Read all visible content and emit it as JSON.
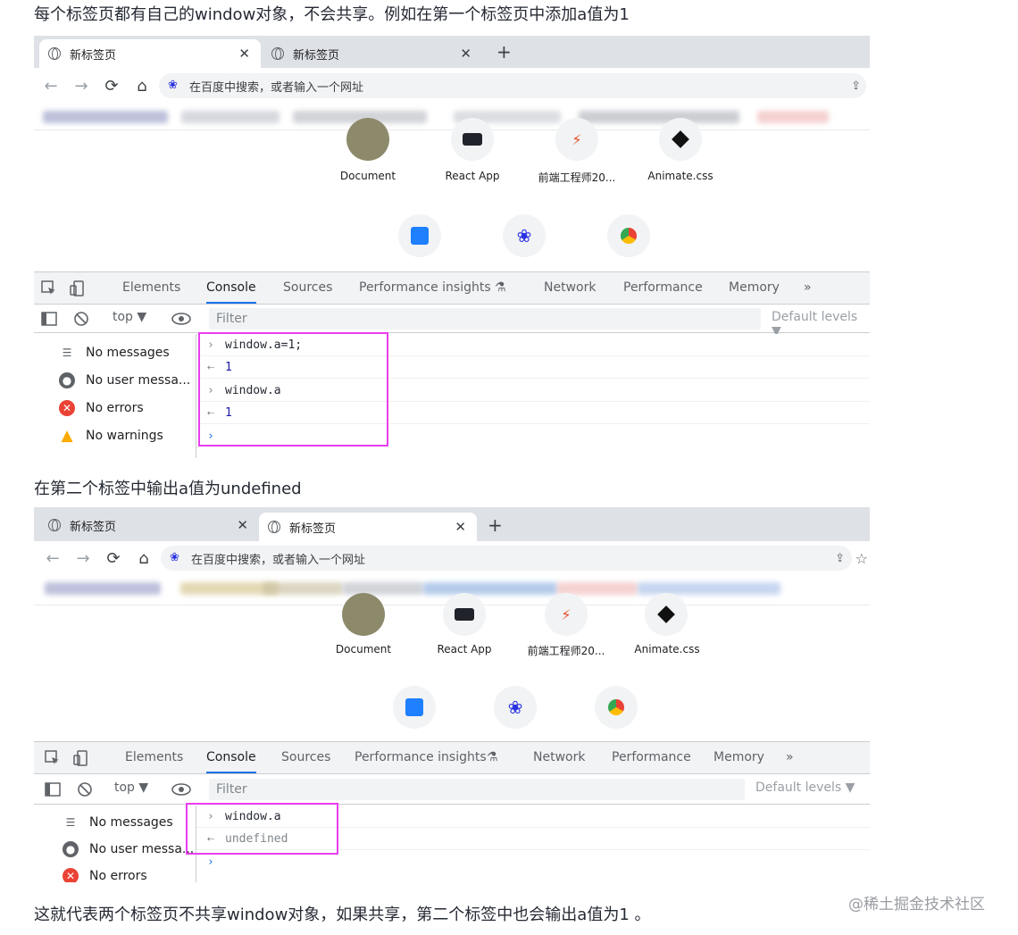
{
  "paragraphs": {
    "p1": "每个标签页都有自己的window对象，不会共享。例如在第一个标签页中添加a值为1",
    "p2": "在第二个标签中输出a值为undefined",
    "p3": "这就代表两个标签页不共享window对象，如果共享，第二个标签中也会输出a值为1 。"
  },
  "watermark": "@稀土掘金技术社区",
  "shot1": {
    "tabs": [
      "新标签页",
      "新标签页"
    ],
    "active_tab": 0,
    "omnibox_placeholder": "在百度中搜索，或者输入一个网址",
    "shortcuts": [
      "Document",
      "React App",
      "前端工程师20...",
      "Animate.css"
    ],
    "devtools_tabs": [
      "Elements",
      "Console",
      "Sources",
      "Performance insights",
      "Network",
      "Performance",
      "Memory",
      "»"
    ],
    "context": "top ▼",
    "filter_placeholder": "Filter",
    "default_levels": "Default levels ▼",
    "sidebar": [
      "No messages",
      "No user messa...",
      "No errors",
      "No warnings"
    ],
    "console": [
      {
        "type": "input",
        "text": "window.a=1;"
      },
      {
        "type": "output",
        "text": "1"
      },
      {
        "type": "input",
        "text": "window.a"
      },
      {
        "type": "output",
        "text": "1"
      }
    ]
  },
  "shot2": {
    "tabs": [
      "新标签页",
      "新标签页"
    ],
    "active_tab": 1,
    "omnibox_placeholder": "在百度中搜索，或者输入一个网址",
    "shortcuts": [
      "Document",
      "React App",
      "前端工程师20...",
      "Animate.css"
    ],
    "devtools_tabs": [
      "Elements",
      "Console",
      "Sources",
      "Performance insights",
      "Network",
      "Performance",
      "Memory",
      "»"
    ],
    "context": "top ▼",
    "filter_placeholder": "Filter",
    "default_levels": "Default levels ▼",
    "sidebar": [
      "No messages",
      "No user messa...",
      "No errors"
    ],
    "console": [
      {
        "type": "input",
        "text": "window.a"
      },
      {
        "type": "output",
        "text": "undefined"
      }
    ]
  },
  "colors": {
    "highlight": "#e83ef0",
    "active_tab_underline": "#1a73e8",
    "error": "#ea4335",
    "warning": "#f9ab00"
  }
}
